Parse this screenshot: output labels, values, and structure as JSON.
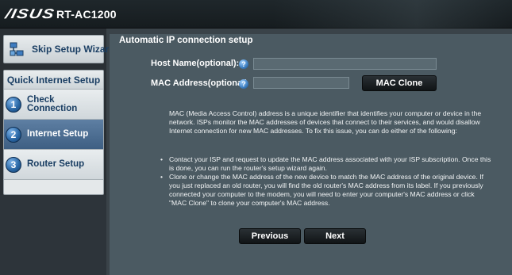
{
  "header": {
    "logo": "/ISUS",
    "model": "RT-AC1200"
  },
  "sidebar": {
    "skip_label": "Skip Setup Wizard",
    "menu_title": "Quick Internet Setup",
    "items": [
      {
        "step": "1",
        "label_line1": "Check",
        "label_line2": "Connection",
        "active": false
      },
      {
        "step": "2",
        "label_line1": "Internet Setup",
        "label_line2": "",
        "active": true
      },
      {
        "step": "3",
        "label_line1": "Router Setup",
        "label_line2": "",
        "active": false
      }
    ]
  },
  "main": {
    "section_title": "Automatic IP connection setup",
    "host_name_label": "Host Name(optional):",
    "host_name_value": "",
    "mac_address_label": "MAC Address(optional)",
    "mac_address_value": "",
    "help_glyph": "?",
    "mac_clone_label": "MAC Clone",
    "description": "MAC (Media Access Control) address is a unique identifier that identifies your computer or device in the network. ISPs monitor the MAC addresses of devices that connect to their services, and would disallow Internet connection for new MAC addresses. To fix this issue, you can do either of the following:",
    "bullets": [
      "Contact your ISP and request to update the MAC address associated with your ISP subscription. Once this is done, you can run the router's setup wizard again.",
      "Clone or change the MAC address of the new device to match the MAC address of the original device. If you just replaced an old router, you will find the old router's MAC address from its label. If you previously connected your computer to the modem, you will need to enter your computer's MAC address or click \"MAC Clone\" to clone your computer's MAC address."
    ],
    "previous_label": "Previous",
    "next_label": "Next"
  }
}
